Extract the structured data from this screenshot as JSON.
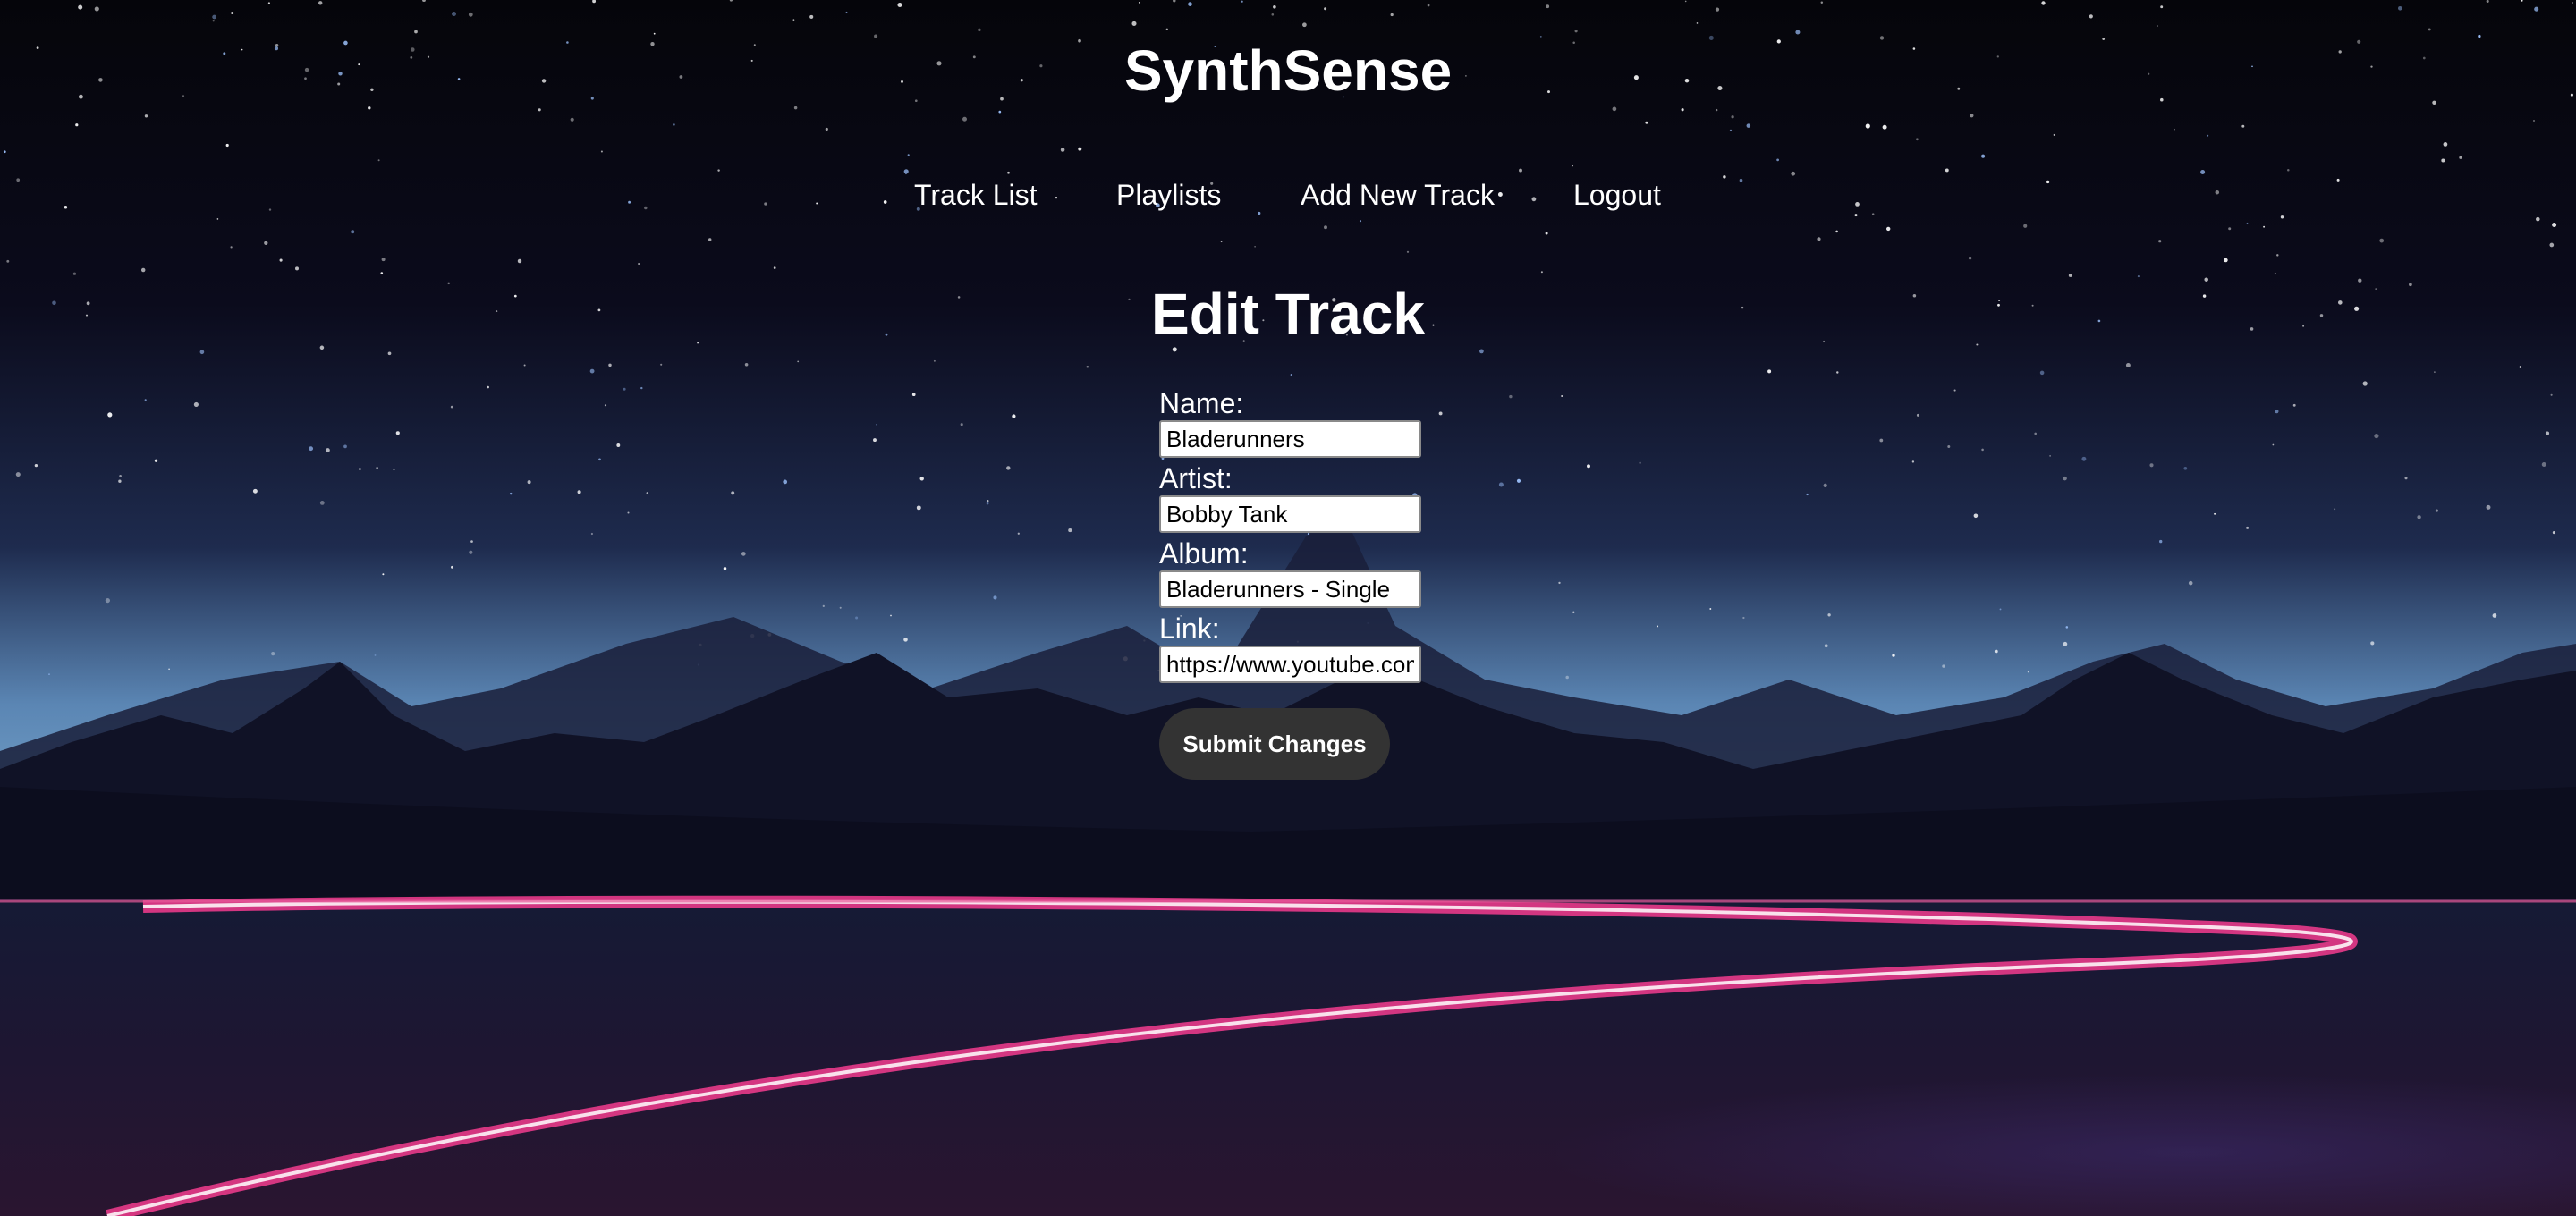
{
  "app": {
    "title": "SynthSense"
  },
  "nav": {
    "items": [
      {
        "label": "Track List"
      },
      {
        "label": "Playlists"
      },
      {
        "label": "Add New Track"
      },
      {
        "label": "Logout"
      }
    ]
  },
  "page": {
    "heading": "Edit Track"
  },
  "form": {
    "name": {
      "label": "Name:",
      "value": "Bladerunners"
    },
    "artist": {
      "label": "Artist:",
      "value": "Bobby Tank"
    },
    "album": {
      "label": "Album:",
      "value": "Bladerunners - Single"
    },
    "link": {
      "label": "Link:",
      "value": "https://www.youtube.com"
    },
    "submit_label": "Submit Changes"
  },
  "colors": {
    "text": "#ffffff",
    "button_bg": "#333333",
    "sky_top": "#05050a",
    "horizon_glow": "#6f9cc4",
    "neon_pink": "#e83a8a"
  }
}
